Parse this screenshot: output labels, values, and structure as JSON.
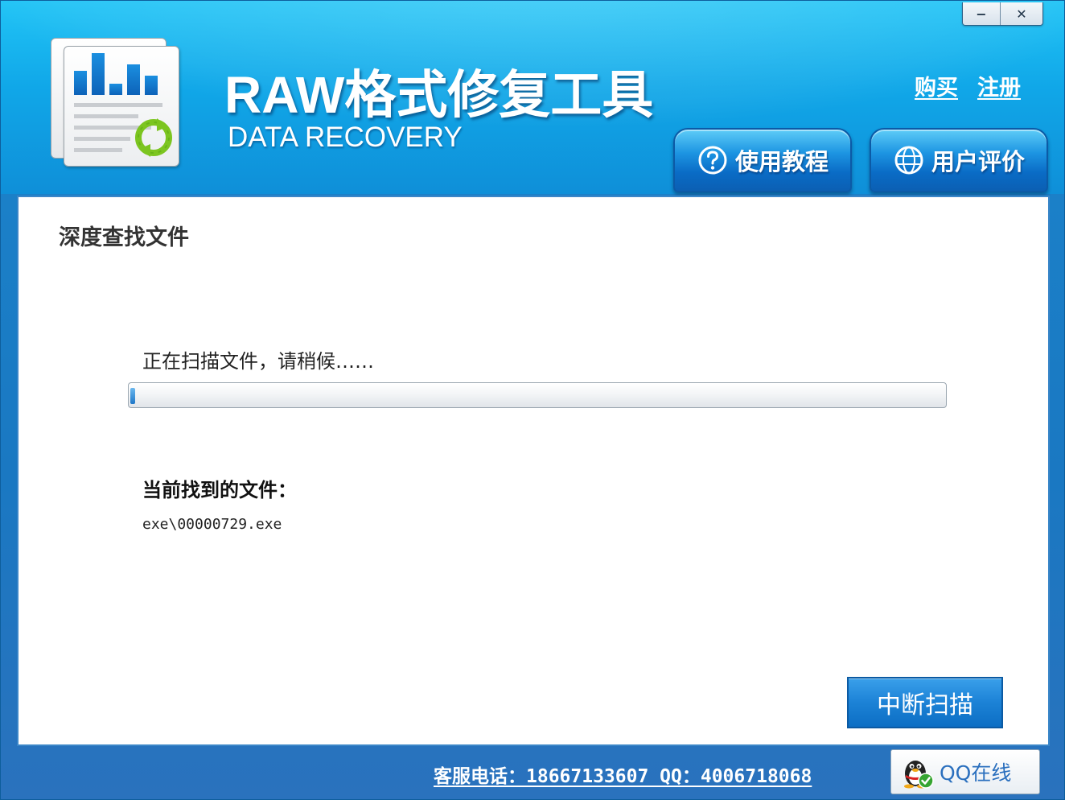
{
  "window": {
    "minimize_label": "−",
    "close_label": "✕"
  },
  "header": {
    "title": "RAW格式修复工具",
    "subtitle": "DATA RECOVERY",
    "links": {
      "buy": "购买",
      "register": "注册"
    },
    "buttons": {
      "tutorial": "使用教程",
      "reviews": "用户评价"
    }
  },
  "main": {
    "section_title": "深度查找文件",
    "status_text": "正在扫描文件，请稍候……",
    "progress_fraction": 0.006,
    "found_label": "当前找到的文件：",
    "found_file": "exe\\00000729.exe",
    "stop_button": "中断扫描"
  },
  "footer": {
    "contact": "客服电话：18667133607 QQ：4006718068",
    "qq_button": "QQ在线"
  },
  "colors": {
    "header_blue": "#10a7e8",
    "frame_blue": "#1b80c8",
    "button_blue": "#1c82d6",
    "progress_fill": "#1f77c8",
    "bar_blue": "#0d62b8",
    "refresh_green": "#7cc520"
  },
  "icons": {
    "logo": "document-chart-refresh-icon",
    "tutorial": "question-circle-icon",
    "reviews": "globe-icon",
    "qq": "qq-penguin-icon"
  }
}
